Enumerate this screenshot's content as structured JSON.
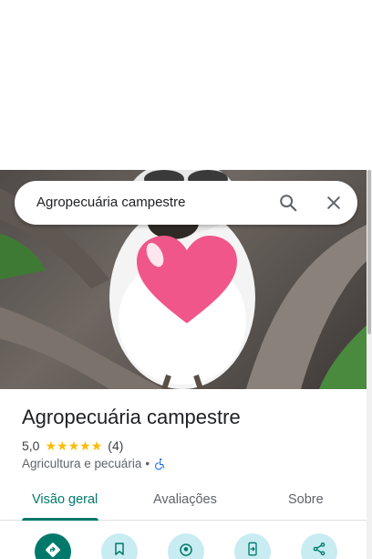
{
  "search": {
    "query": "Agropecuária campestre"
  },
  "place": {
    "title": "Agropecuária campestre",
    "rating": "5,0",
    "stars": 5,
    "review_count": "(4)",
    "category": "Agricultura e pecuária",
    "separator": "•"
  },
  "tabs": [
    {
      "label": "Visão geral",
      "active": true
    },
    {
      "label": "Avaliações",
      "active": false
    },
    {
      "label": "Sobre",
      "active": false
    }
  ],
  "actions": [
    {
      "icon": "directions-icon"
    },
    {
      "icon": "bookmark-icon"
    },
    {
      "icon": "nearby-icon"
    },
    {
      "icon": "send-to-phone-icon"
    },
    {
      "icon": "share-icon"
    }
  ],
  "colors": {
    "accent": "#00796b",
    "action_bg": "#c8ecf2",
    "star": "#fbbc04",
    "heart": "#f0568a"
  }
}
